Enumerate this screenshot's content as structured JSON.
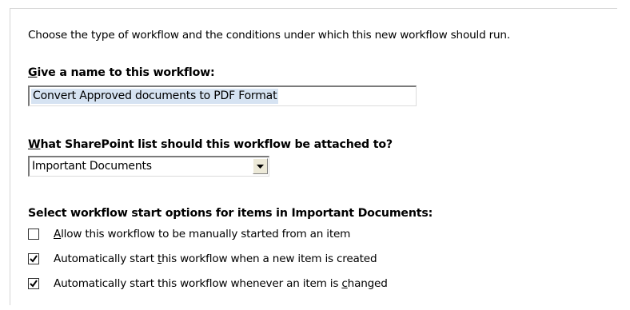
{
  "intro_text": "Choose the type of workflow and the conditions under which this new workflow should run.",
  "name_section": {
    "heading_accel": "G",
    "heading_rest": "ive a name to this workflow:",
    "input_value": "Convert Approved documents to PDF Format"
  },
  "list_section": {
    "heading_accel": "W",
    "heading_rest": "hat SharePoint list should this workflow be attached to?",
    "selected_list": "Important Documents"
  },
  "start_section": {
    "heading": "Select workflow start options for items in Important Documents:",
    "options": [
      {
        "pre": "",
        "accel": "A",
        "post": "llow this workflow to be manually started from an item",
        "checked": false
      },
      {
        "pre": "Automatically start ",
        "accel": "t",
        "post": "his workflow when a new item is created",
        "checked": true
      },
      {
        "pre": "Automatically start this workflow whenever an item is ",
        "accel": "c",
        "post": "hanged",
        "checked": true
      }
    ]
  },
  "colors": {
    "selection_highlight": "#d6e3f2",
    "frame_border": "#d4d4d4"
  },
  "icons": {
    "dropdown": "chevron-down-icon",
    "checked": "checkmark-icon"
  }
}
